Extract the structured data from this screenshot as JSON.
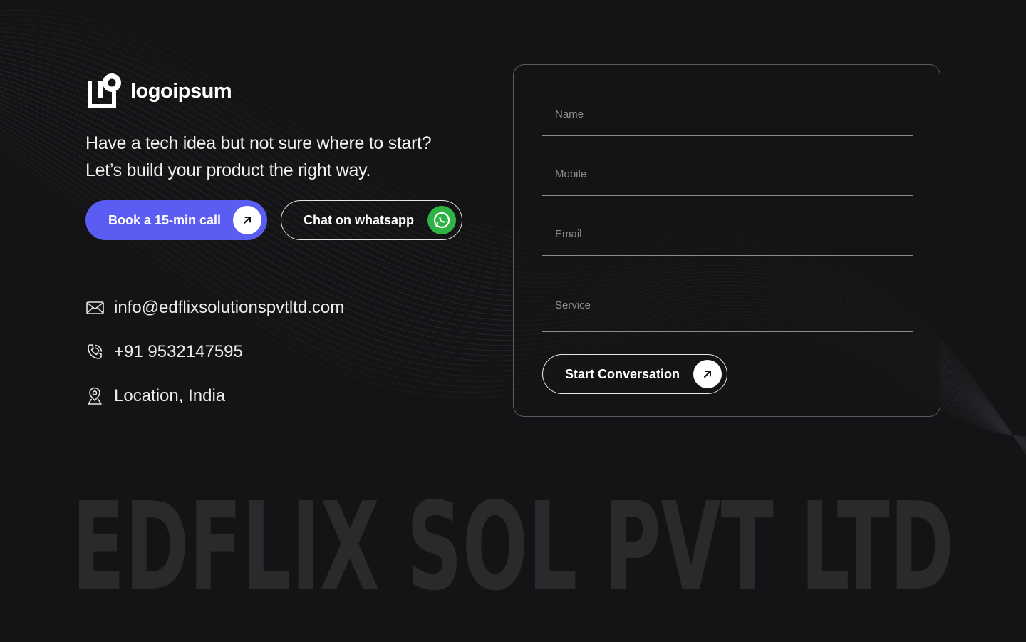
{
  "brand": {
    "logo_text": "logoipsum"
  },
  "hero": {
    "line1": "Have a tech idea but not sure where to start?",
    "line2": "Let’s build your product the right way."
  },
  "buttons": {
    "book_call": "Book a 15-min call",
    "whatsapp": "Chat on whatsapp"
  },
  "contact": {
    "email": "info@edflixsolutionspvtltd.com",
    "phone": "+91 9532147595",
    "location": "Location, India"
  },
  "form": {
    "name_placeholder": "Name",
    "mobile_placeholder": "Mobile",
    "email_placeholder": "Email",
    "service_placeholder": "Service",
    "submit_label": "Start Conversation"
  },
  "footer": {
    "watermark": "EDFLIX SOL PVT LTD"
  },
  "colors": {
    "background": "#141416",
    "primary": "#5a5cf2",
    "whatsapp": "#2fb344",
    "watermark": "#2a2a2d"
  },
  "icons": {
    "book_call": "arrow-up-right-icon",
    "whatsapp": "whatsapp-icon",
    "email": "mail-icon",
    "phone": "phone-icon",
    "location": "location-pin-icon",
    "submit": "arrow-up-right-icon"
  }
}
